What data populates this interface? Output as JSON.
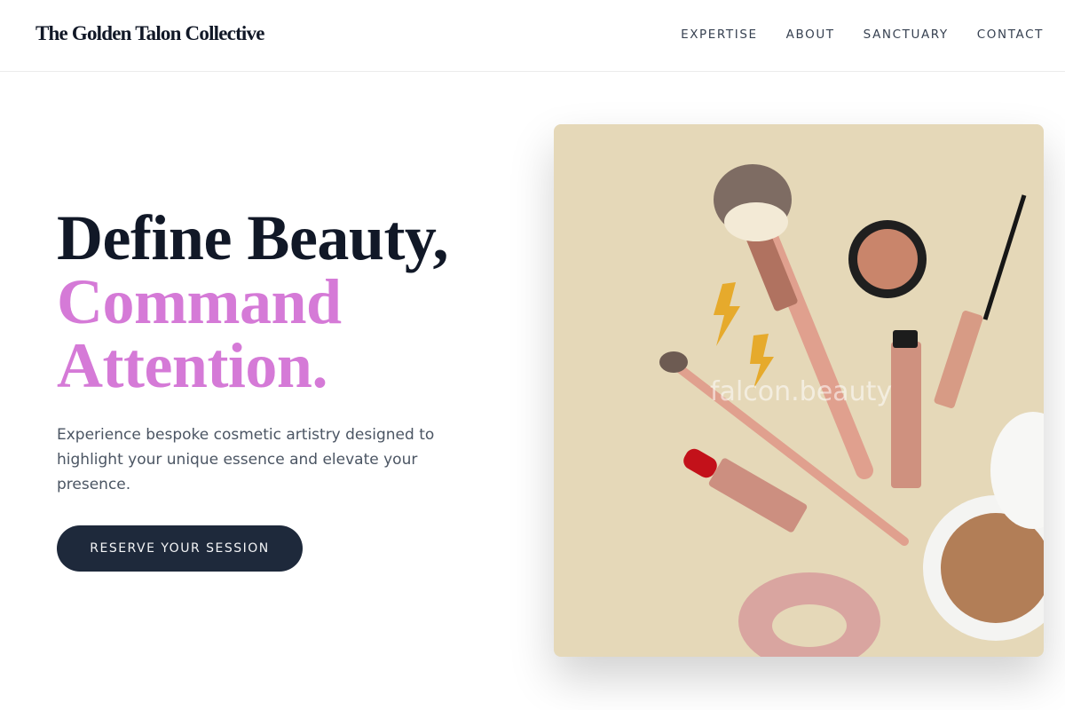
{
  "header": {
    "brand": "The Golden Talon Collective",
    "nav": [
      "EXPERTISE",
      "ABOUT",
      "SANCTUARY",
      "CONTACT"
    ]
  },
  "hero": {
    "title_line1": "Define Beauty,",
    "title_accent_line1": "Command",
    "title_accent_line2": "Attention.",
    "description": "Experience bespoke cosmetic artistry designed to highlight your unique essence and elevate your presence.",
    "cta_label": "RESERVE YOUR SESSION",
    "accent_color": "#d57ad7"
  },
  "image": {
    "watermark": "falcon.beauty",
    "subject": "makeup-flatlay"
  }
}
